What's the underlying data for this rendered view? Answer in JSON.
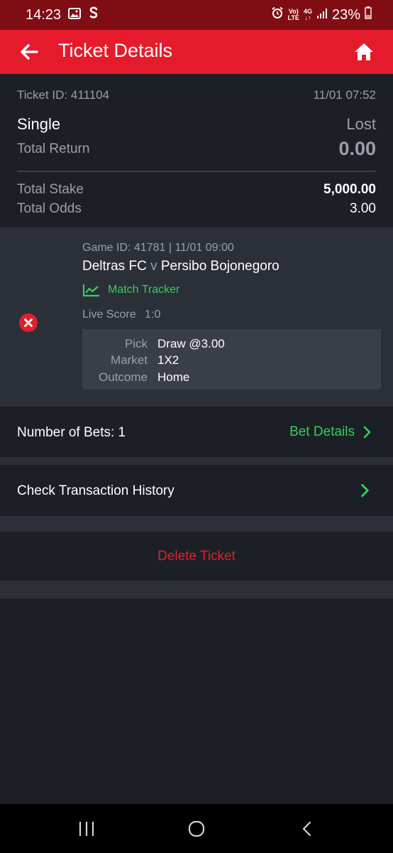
{
  "status_bar": {
    "time": "14:23",
    "network_top": "Vo)",
    "network_bottom": "LTE",
    "signal_top": "4G",
    "battery": "23%"
  },
  "header": {
    "title": "Ticket Details"
  },
  "ticket": {
    "id_label": "Ticket ID: 411104",
    "datetime": "11/01 07:52",
    "type": "Single",
    "status": "Lost",
    "total_return_label": "Total Return",
    "total_return": "0.00",
    "total_stake_label": "Total Stake",
    "total_stake": "5,000.00",
    "total_odds_label": "Total Odds",
    "total_odds": "3.00"
  },
  "selection": {
    "game_info": "Game ID: 41781 | 11/01 09:00",
    "home_team": "Deltras FC",
    "versus": "v",
    "away_team": "Persibo Bojonegoro",
    "tracker_label": "Match Tracker",
    "live_score_label": "Live Score",
    "live_score": "1:0",
    "pick_label": "Pick",
    "pick_value": "Draw @3.00",
    "market_label": "Market",
    "market_value": "1X2",
    "outcome_label": "Outcome",
    "outcome_value": "Home"
  },
  "bets": {
    "count_label": "Number of Bets: 1",
    "details_link": "Bet Details"
  },
  "history": {
    "label": "Check Transaction History"
  },
  "actions": {
    "delete_label": "Delete Ticket"
  },
  "colors": {
    "brand_red": "#e51b2b",
    "accent_green": "#35d05a",
    "danger": "#e0202f"
  }
}
